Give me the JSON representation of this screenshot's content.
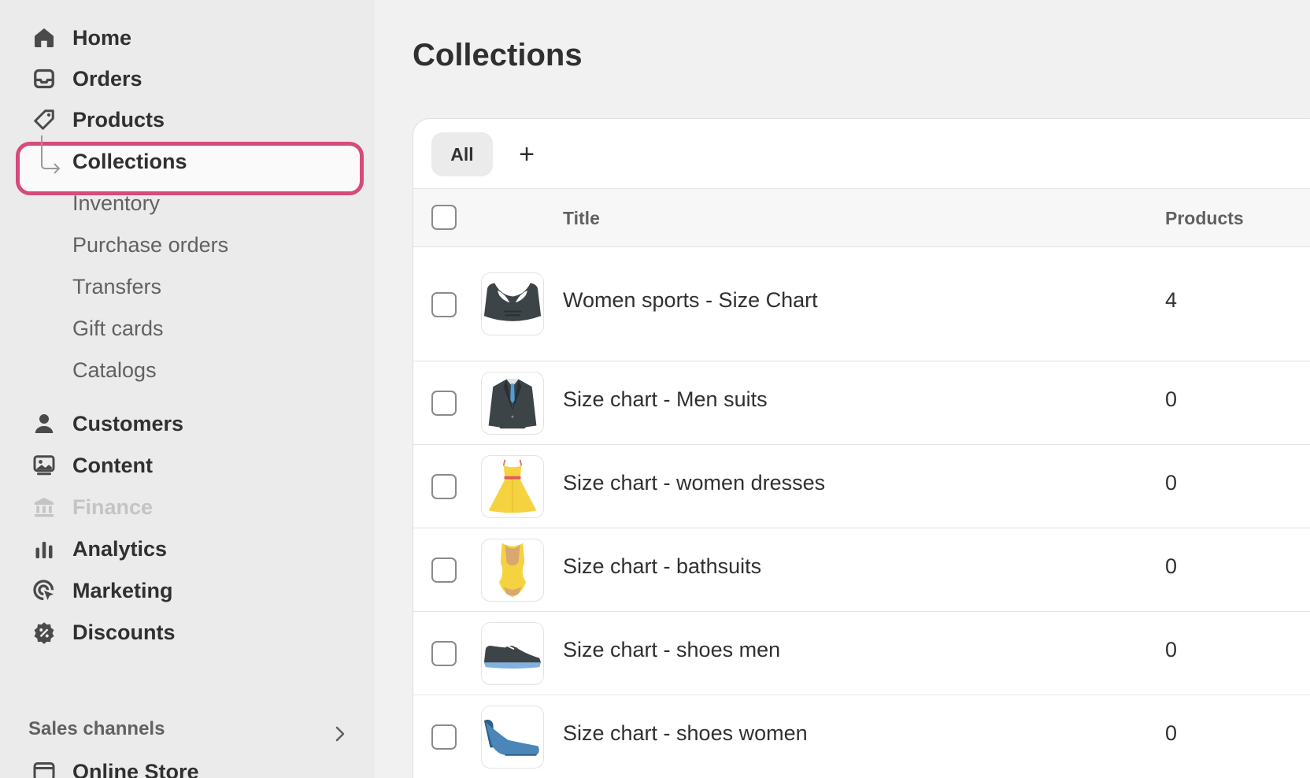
{
  "sidebar": {
    "items": [
      {
        "label": "Home",
        "icon": "home-icon"
      },
      {
        "label": "Orders",
        "icon": "inbox-icon"
      },
      {
        "label": "Products",
        "icon": "tag-icon"
      },
      {
        "label": "Collections",
        "icon": "sub-arrow-icon",
        "selected": true
      },
      {
        "label": "Inventory"
      },
      {
        "label": "Purchase orders"
      },
      {
        "label": "Transfers"
      },
      {
        "label": "Gift cards"
      },
      {
        "label": "Catalogs"
      },
      {
        "label": "Customers",
        "icon": "person-icon"
      },
      {
        "label": "Content",
        "icon": "image-icon"
      },
      {
        "label": "Finance",
        "icon": "bank-icon",
        "disabled": true
      },
      {
        "label": "Analytics",
        "icon": "bar-chart-icon"
      },
      {
        "label": "Marketing",
        "icon": "target-icon"
      },
      {
        "label": "Discounts",
        "icon": "discount-icon"
      },
      {
        "label": "Online Store",
        "icon": "store-icon"
      }
    ],
    "sales_channels": "Sales channels",
    "highlight_color": "#d64a7c"
  },
  "main": {
    "title": "Collections",
    "tabs": [
      {
        "label": "All"
      }
    ],
    "add_tab": "+",
    "table": {
      "headers": {
        "title": "Title",
        "products": "Products"
      },
      "rows": [
        {
          "title": "Women sports - Size Chart",
          "products": "4",
          "image": "sports-bra-icon"
        },
        {
          "title": "Size chart - Men suits",
          "products": "0",
          "image": "suit-jacket-icon"
        },
        {
          "title": "Size chart - women dresses",
          "products": "0",
          "image": "dress-icon"
        },
        {
          "title": "Size chart - bathsuits",
          "products": "0",
          "image": "swimsuit-icon"
        },
        {
          "title": "Size chart - shoes men",
          "products": "0",
          "image": "sneaker-icon"
        },
        {
          "title": "Size chart - shoes women",
          "products": "0",
          "image": "high-heel-icon"
        }
      ]
    }
  }
}
